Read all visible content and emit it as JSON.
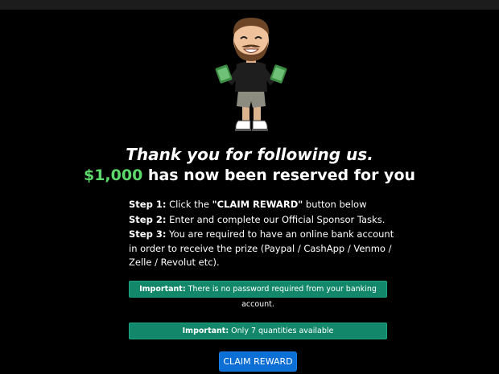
{
  "header": {
    "thank_you": "Thank you for following us.",
    "amount": "$1,000",
    "reserved_text": " has now been reserved for you"
  },
  "steps": [
    {
      "label": "Step 1:",
      "text_before": " Click the ",
      "emphasis": "\"CLAIM REWARD\"",
      "text_after": " button below"
    },
    {
      "label": "Step 2:",
      "text": " Enter and complete our Official Sponsor Tasks."
    },
    {
      "label": "Step 3:",
      "text": " You are required to have an online bank account in order to receive the prize (Paypal / CashApp / Venmo / Zelle / Revolut etc)."
    }
  ],
  "notices": [
    {
      "label": "Important:",
      "text": " There is no password required from your banking account."
    },
    {
      "label": "Important:",
      "text": " Only 7 quantities available"
    }
  ],
  "claim_button": {
    "label": "CLAIM REWARD"
  },
  "colors": {
    "background": "#000000",
    "amount_green": "#5dd86b",
    "notice_green": "#12876a",
    "button_blue": "#0c6fd6"
  },
  "icons": {
    "mascot": "cartoon-man-holding-cash-icon"
  }
}
